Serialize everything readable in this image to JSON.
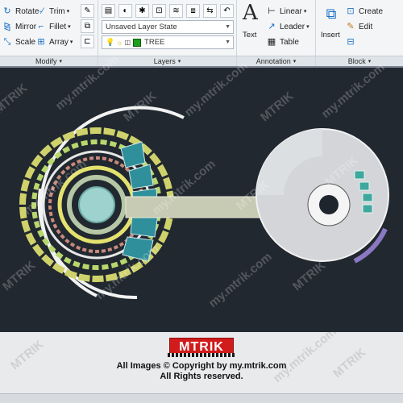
{
  "ribbon": {
    "modify": {
      "title": "Modify",
      "rotate": "Rotate",
      "trim": "Trim",
      "mirror": "Mirror",
      "fillet": "Fillet",
      "scale": "Scale",
      "array": "Array"
    },
    "layers": {
      "title": "Layers",
      "layer_state": "Unsaved Layer State",
      "current_layer": "TREE",
      "current_layer_color": "#1aa01a"
    },
    "annotation": {
      "title": "Annotation",
      "text": "Text",
      "linear": "Linear",
      "leader": "Leader",
      "table": "Table"
    },
    "block": {
      "title": "Block",
      "insert": "Insert",
      "create": "Create",
      "edit": "Edit"
    }
  },
  "colors": {
    "canvas_background": "#212830",
    "accent_red": "#d21b1b"
  },
  "watermark": {
    "brand": "MTRIK",
    "site": "my.mtrik.com"
  },
  "footer": {
    "logo": "MTRIK",
    "copyright": "All Images © Copyright by my.mtrik.com",
    "rights": "All Rights reserved."
  }
}
